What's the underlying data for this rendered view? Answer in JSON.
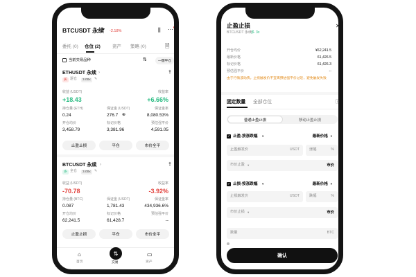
{
  "left": {
    "header": {
      "symbol": "BTCUSDT 永续",
      "change": "-2.18%"
    },
    "tabs": [
      "委托 (0)",
      "仓位 (2)",
      "资产",
      "策略 (0)"
    ],
    "filter": {
      "label": "当前交易品种",
      "close_all": "一键平仓"
    },
    "positions": [
      {
        "symbol": "ETHUSDT 永续",
        "side": "买",
        "mode": "逐仓",
        "leverage": "3.00x",
        "pnl_label": "收益 (USDT)",
        "pnl": "+18.43",
        "roe_label": "收益率",
        "roe": "+6.66%",
        "size_label": "持仓量 (ETH)",
        "size": "0.24",
        "margin_label": "保证金 (USDT)",
        "margin": "276.7",
        "ratio_label": "保证金率",
        "ratio": "8,080.53%",
        "entry_label": "开仓均价",
        "entry": "3,458.79",
        "mark_label": "标记价格",
        "mark": "3,381.96",
        "liq_label": "预估强平价",
        "liq": "4,591.05",
        "buttons": [
          "止盈止损",
          "平仓",
          "市价全平"
        ]
      },
      {
        "symbol": "BTCUSDT 永续",
        "side": "多",
        "mode": "全仓",
        "leverage": "3.00x",
        "pnl_label": "收益 (USDT)",
        "pnl": "-70.78",
        "roe_label": "收益率",
        "roe": "-3.92%",
        "size_label": "持仓量 (BTC)",
        "size": "0.087",
        "margin_label": "保证金 (USDT)",
        "margin": "1,781.43",
        "ratio_label": "保证金率",
        "ratio": "434,936.6%",
        "entry_label": "开仓均价",
        "entry": "62,241.5",
        "mark_label": "标记价格",
        "mark": "61,428.7",
        "liq_label": "预估强平价",
        "liq": "--",
        "buttons": [
          "止盈止损",
          "平仓",
          "市价全平"
        ]
      }
    ],
    "nav": [
      "首页",
      "交易",
      "资产"
    ]
  },
  "right": {
    "title": "止盈止损",
    "subtitle_symbol": "BTCUSDT 永续",
    "subtitle_side": "多",
    "subtitle_lev": "3x",
    "info": [
      {
        "label": "开仓均价",
        "value": "¥62,241.5"
      },
      {
        "label": "最新价格",
        "value": "61,426.5"
      },
      {
        "label": "标记价格",
        "value": "61,426.3"
      },
      {
        "label": "预估强平价",
        "value": "--"
      }
    ],
    "warning": "由于行情波动快，止损触发价不宜离预估强平价过近，避免触发失败",
    "tabs": [
      "固定数量",
      "全部仓位"
    ],
    "segment": [
      "普通止盈止损",
      "移动止盈止损"
    ],
    "tp": {
      "label": "止盈-按涨跌幅",
      "trigger_type": "最新价格",
      "trigger_placeholder": "止盈触发价",
      "unit": "USDT",
      "pct_placeholder": "涨幅",
      "pct_unit": "%",
      "order_label": "市价止盈",
      "order_type": "市价"
    },
    "sl": {
      "label": "止损-按涨跌幅",
      "trigger_type": "最新价格",
      "trigger_placeholder": "止损触发价",
      "unit": "USDT",
      "pct_placeholder": "跌幅",
      "pct_unit": "%",
      "order_label": "市价止损",
      "order_type": "市价"
    },
    "qty": {
      "placeholder": "数量",
      "unit": "BTC"
    },
    "confirm": "确认"
  }
}
